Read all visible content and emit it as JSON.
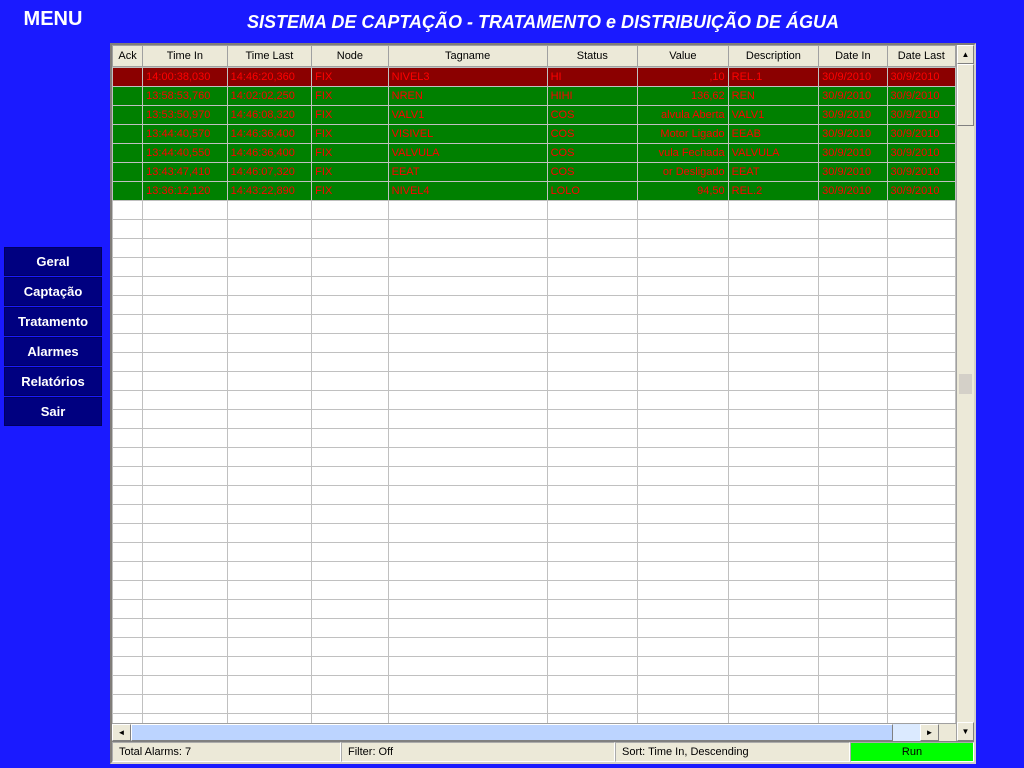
{
  "menu": {
    "title": "MENU",
    "items": [
      {
        "label": "Geral"
      },
      {
        "label": "Captação"
      },
      {
        "label": "Tratamento"
      },
      {
        "label": "Alarmes"
      },
      {
        "label": "Relatórios"
      },
      {
        "label": "Sair"
      }
    ]
  },
  "title": "SISTEMA DE CAPTAÇÃO - TRATAMENTO e DISTRIBUIÇÃO DE ÁGUA",
  "columns": [
    "Ack",
    "Time In",
    "Time Last",
    "Node",
    "Tagname",
    "Status",
    "Value",
    "Description",
    "Date In",
    "Date Last"
  ],
  "rows": [
    {
      "cls": "alarm-hi",
      "ack": "",
      "timein": "14:00:38,030",
      "timelast": "14:46:20,360",
      "node": "FIX",
      "tag": "NIVEL3",
      "status": "HI",
      "value": ",10",
      "desc": "REL.1",
      "datein": "30/9/2010",
      "datelast": "30/9/2010"
    },
    {
      "cls": "alarm-green",
      "ack": "",
      "timein": "13:58:53,760",
      "timelast": "14:02:02,250",
      "node": "FIX",
      "tag": "NREN",
      "status": "HIHI",
      "value": "136,62",
      "desc": "REN",
      "datein": "30/9/2010",
      "datelast": "30/9/2010"
    },
    {
      "cls": "alarm-green",
      "ack": "",
      "timein": "13:53:50,970",
      "timelast": "14:46:08,320",
      "node": "FIX",
      "tag": "VALV1",
      "status": "COS",
      "value": "alvula Aberta",
      "desc": "VALV1",
      "datein": "30/9/2010",
      "datelast": "30/9/2010"
    },
    {
      "cls": "alarm-green",
      "ack": "",
      "timein": "13:44:40,570",
      "timelast": "14:46:36,400",
      "node": "FIX",
      "tag": "VISIVEL",
      "status": "COS",
      "value": "Motor Ligado",
      "desc": "EEAB",
      "datein": "30/9/2010",
      "datelast": "30/9/2010"
    },
    {
      "cls": "alarm-green",
      "ack": "",
      "timein": "13:44:40,550",
      "timelast": "14:46:36,400",
      "node": "FIX",
      "tag": "VALVULA",
      "status": "COS",
      "value": "vula Fechada",
      "desc": "VALVULA",
      "datein": "30/9/2010",
      "datelast": "30/9/2010"
    },
    {
      "cls": "alarm-green",
      "ack": "",
      "timein": "13:43:47,410",
      "timelast": "14:46:07,320",
      "node": "FIX",
      "tag": "EEAT",
      "status": "COS",
      "value": "or Desligado",
      "desc": "EEAT",
      "datein": "30/9/2010",
      "datelast": "30/9/2010"
    },
    {
      "cls": "alarm-green",
      "ack": "",
      "timein": "13:36:12,120",
      "timelast": "14:43:22,890",
      "node": "FIX",
      "tag": "NIVEL4",
      "status": "LOLO",
      "value": "94,50",
      "desc": "REL.2",
      "datein": "30/9/2010",
      "datelast": "30/9/2010"
    }
  ],
  "empty_rows": 30,
  "status": {
    "total": "Total Alarms: 7",
    "filter": "Filter: Off",
    "sort": "Sort: Time In, Descending",
    "run": "Run"
  }
}
